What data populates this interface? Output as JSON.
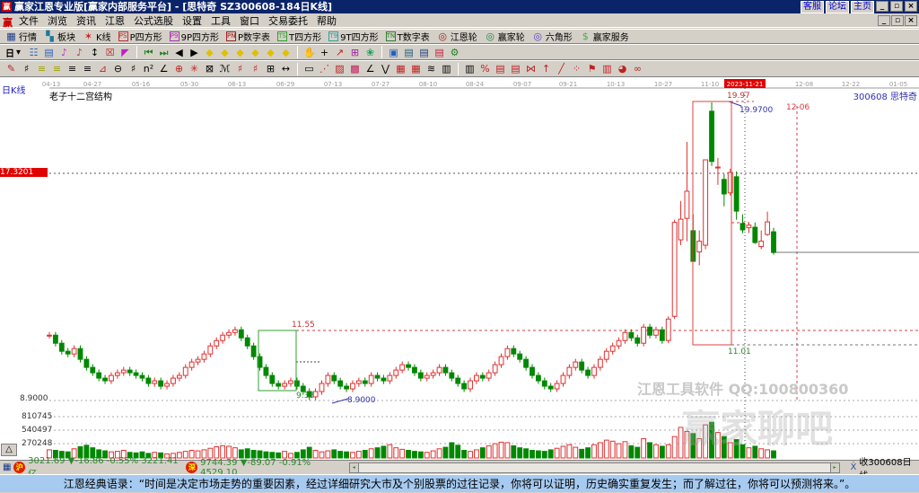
{
  "window": {
    "title": "赢家江恩专业版[赢家内部服务平台] - [思特奇   SZ300608-184日K线]",
    "logo": "赢",
    "links": [
      "客服",
      "论坛",
      "主页"
    ],
    "min": "_",
    "max": "▫",
    "close": "×"
  },
  "menu": [
    "文件",
    "浏览",
    "资讯",
    "江恩",
    "公式选股",
    "设置",
    "工具",
    "窗口",
    "交易委托",
    "帮助"
  ],
  "toolbar1": [
    {
      "icon": "grid-icon",
      "tag": "▦",
      "label": "行情",
      "color": "#1a3a8a"
    },
    {
      "icon": "blocks-icon",
      "tag": "▚",
      "label": "板块",
      "color": "#1a7a9a"
    },
    {
      "icon": "kline-icon",
      "tag": "✶",
      "label": "K线",
      "color": "#d02020"
    },
    {
      "icon": "ps-icon",
      "tag": "PS",
      "label": "P四方形",
      "color": "#c03030"
    },
    {
      "icon": "p9-icon",
      "tag": "P9",
      "label": "9P四方形",
      "color": "#b030b0"
    },
    {
      "icon": "pn-icon",
      "tag": "PN",
      "label": "P数字表",
      "color": "#a02020"
    },
    {
      "icon": "ts-icon",
      "tag": "TS",
      "label": "T四方形",
      "color": "#30a030"
    },
    {
      "icon": "t9-icon",
      "tag": "T9",
      "label": "9T四方形",
      "color": "#30a0a0"
    },
    {
      "icon": "tn-icon",
      "tag": "TN",
      "label": "T数字表",
      "color": "#308030"
    },
    {
      "icon": "gann-wheel-icon",
      "tag": "◎",
      "label": "江恩轮",
      "color": "#a02020"
    },
    {
      "icon": "winner-wheel-icon",
      "tag": "◎",
      "label": "赢家轮",
      "color": "#208040"
    },
    {
      "icon": "hexagon-icon",
      "tag": "◎",
      "label": "六角形",
      "color": "#6040c0"
    },
    {
      "icon": "dollar-icon",
      "tag": "$",
      "label": "赢家服务",
      "color": "#40b040"
    }
  ],
  "toolbar2": {
    "period": "日",
    "icons": [
      [
        "chart-type-icon",
        "☷",
        "#3060c0"
      ],
      [
        "list-icon",
        "▤",
        "#3060c0"
      ],
      [
        "indicator-a-icon",
        "♪",
        "#c030c0"
      ],
      [
        "indicator-b-icon",
        "♪",
        "#c03060"
      ],
      [
        "candle-select-icon",
        "↕",
        "#000"
      ],
      [
        "compare-icon",
        "☒",
        "#c02020"
      ],
      [
        "color-flag-icon",
        "◤",
        "#c020c0"
      ],
      [
        "first-icon",
        "⏮",
        "#208020"
      ],
      [
        "last-icon",
        "⏭",
        "#208020"
      ],
      [
        "left-icon",
        "◀",
        "#000"
      ],
      [
        "right-icon",
        "▶",
        "#000"
      ],
      [
        "zoom-a-icon",
        "◆",
        "#e0c000"
      ],
      [
        "zoom-b-icon",
        "◆",
        "#e0c000"
      ],
      [
        "zoom-c-icon",
        "◆",
        "#e0c000"
      ],
      [
        "zoom-d-icon",
        "◆",
        "#e0c000"
      ],
      [
        "zoom-e-icon",
        "◆",
        "#e0c000"
      ],
      [
        "zoom-f-icon",
        "◆",
        "#e0c000"
      ],
      [
        "hand-icon",
        "✋",
        "#000"
      ],
      [
        "crosshair-icon",
        "+",
        "#000"
      ],
      [
        "draw-line-icon",
        "↗",
        "#c02020"
      ],
      [
        "calc-icon",
        "⊞",
        "#a020a0"
      ],
      [
        "brain-icon",
        "❀",
        "#20a060"
      ],
      [
        "calendar-icon",
        "▣",
        "#2060c0"
      ],
      [
        "save-a-icon",
        "▤",
        "#206080"
      ],
      [
        "save-b-icon",
        "▤",
        "#204080"
      ],
      [
        "disk-icon",
        "▤",
        "#c02040"
      ],
      [
        "network-icon",
        "⚙",
        "#208020"
      ]
    ]
  },
  "toolbar3": {
    "icons": [
      [
        "pen-icon",
        "✎",
        "#c02020"
      ],
      [
        "hash-icon",
        "♯",
        "#000"
      ],
      [
        "gann-a-icon",
        "≡",
        "#a0a000"
      ],
      [
        "gann-b-icon",
        "≡",
        "#a0a000"
      ],
      [
        "gann-c-icon",
        "≡",
        "#000"
      ],
      [
        "gann-d-icon",
        "≡",
        "#000"
      ],
      [
        "fan-icon",
        "⊿",
        "#c02020"
      ],
      [
        "circle-icon",
        "⊖",
        "#000"
      ],
      [
        "grid-lines-icon",
        "♯",
        "#000"
      ],
      [
        "n2-icon",
        "n²",
        "#000"
      ],
      [
        "angle-icon",
        "∠",
        "#000"
      ],
      [
        "target-icon",
        "⊕",
        "#c02020"
      ],
      [
        "star-icon",
        "✳",
        "#c02020"
      ],
      [
        "box-icon",
        "⊠",
        "#000"
      ],
      [
        "wave-icon",
        "ℳ",
        "#000"
      ],
      [
        "red-a-icon",
        "♯",
        "#c02020"
      ],
      [
        "red-b-icon",
        "♯",
        "#c02020"
      ],
      [
        "bars-icon",
        "⊞",
        "#000"
      ],
      [
        "range-icon",
        "↔",
        "#000"
      ],
      [
        "rect-icon",
        "▭",
        "#000"
      ],
      [
        "fan-lines-icon",
        "⋰",
        "#c02020"
      ],
      [
        "square-fan-icon",
        "▨",
        "#c02020"
      ],
      [
        "square-grid-icon",
        "▩",
        "#c02060"
      ],
      [
        "angle-lines-icon",
        "∠",
        "#000"
      ],
      [
        "zigzag-icon",
        "⋁",
        "#000"
      ],
      [
        "matrix-icon",
        "▦",
        "#c02020"
      ],
      [
        "matrix-b-icon",
        "▦",
        "#c02020"
      ],
      [
        "parallel-icon",
        "≋",
        "#000"
      ],
      [
        "table-icon",
        "▥",
        "#000"
      ],
      [
        "table-b-icon",
        "▥",
        "#000"
      ],
      [
        "percent-icon",
        "%",
        "#c02020"
      ],
      [
        "bars2-icon",
        "▤",
        "#c02020"
      ],
      [
        "bars3-icon",
        "▤",
        "#c02020"
      ],
      [
        "cycle-icon",
        "⋈",
        "#c02020"
      ],
      [
        "arrow-icon",
        "↑",
        "#c02020"
      ],
      [
        "line-tool-icon",
        "╱",
        "#c02020"
      ],
      [
        "dots-icon",
        "⁘",
        "#c02020"
      ],
      [
        "flag-icon",
        "⚑",
        "#c02020"
      ],
      [
        "chart-icon",
        "▥",
        "#c02020"
      ],
      [
        "pie-icon",
        "◕",
        "#c02020"
      ],
      [
        "loop-icon",
        "∞",
        "#c02020"
      ]
    ]
  },
  "chart": {
    "period_label": "日K线",
    "study_title": "老子十二宫结构",
    "symbol": "300608  思特奇",
    "price_tag": "17.3201",
    "low_label": "8.9000",
    "vol_ticks": [
      "810745",
      "540497",
      "270248"
    ],
    "dates": [
      "04-13",
      "04-27",
      "05-16",
      "05-30",
      "06-13",
      "06-29",
      "07-13",
      "07-27",
      "08-10",
      "08-24",
      "09-07",
      "09-21",
      "10-13",
      "10-27",
      "11-10",
      "2023-11-21",
      "12-08",
      "12-22",
      "01-05"
    ],
    "annotations": {
      "high": "19.97",
      "high_val": "19.9700",
      "low_box_top": "11.55",
      "low_box_bottom": "9.38",
      "low_val": "8.9000",
      "box_low": "11.01",
      "future_date": "12-06"
    },
    "watermark": "江恩工具软件  QQ:100800360",
    "watermark_logo": "赢家聊吧",
    "colors": {
      "up": "#e03030",
      "down": "#008800",
      "accent": "#d00000"
    }
  },
  "chart_data": {
    "type": "candlestick",
    "x_range": [
      "2023-04-13",
      "2024-01-05"
    ],
    "ylim": [
      8.9,
      19.97
    ],
    "early_close": [
      11.3,
      11.0,
      10.7,
      10.6,
      10.8,
      10.4,
      10.1,
      9.9,
      9.7,
      9.6,
      9.8,
      9.9,
      10.0,
      9.9,
      9.8,
      9.7,
      9.5,
      9.6,
      9.4,
      9.5,
      9.7,
      9.8,
      10.1,
      10.3,
      10.4,
      10.6,
      10.9,
      11.1,
      11.3,
      11.4,
      11.5,
      11.2,
      10.9,
      10.5,
      10.1,
      9.8,
      9.5,
      9.4,
      9.5,
      9.6,
      9.4,
      9.2,
      9.0,
      9.2,
      9.5,
      9.8,
      9.6,
      9.4,
      9.3,
      9.5,
      9.6,
      9.5,
      9.8,
      9.7,
      9.6,
      9.8,
      10.0,
      10.2,
      10.1,
      9.9,
      9.7,
      9.8,
      9.9,
      10.1,
      9.9,
      9.7,
      9.5,
      9.3,
      9.6,
      9.8,
      9.7,
      9.9,
      10.2,
      10.5,
      10.8,
      10.6,
      10.4,
      10.1,
      9.8,
      9.6,
      9.4,
      9.3,
      9.5,
      9.8,
      10.1,
      10.3,
      10.0,
      9.8,
      10.1,
      10.4,
      10.7,
      10.9,
      11.1,
      11.4,
      11.2,
      11.0,
      11.6,
      11.3,
      11.5,
      11.1
    ],
    "ohlc": [
      [
        11.1,
        12.0,
        11.0,
        11.9
      ],
      [
        12.0,
        15.6,
        11.9,
        15.5
      ],
      [
        14.85,
        16.3,
        14.65,
        15.62
      ],
      [
        15.65,
        18.5,
        14.8,
        16.66
      ],
      [
        15.19,
        15.8,
        14.1,
        14.05
      ],
      [
        14.4,
        15.2,
        13.9,
        14.8
      ],
      [
        14.65,
        16.8,
        14.5,
        17.83
      ],
      [
        19.64,
        19.97,
        17.6,
        17.77
      ],
      [
        17.56,
        17.9,
        16.9,
        17.56
      ],
      [
        17.1,
        17.3,
        16.1,
        16.56
      ],
      [
        16.6,
        17.5,
        16.5,
        17.36
      ],
      [
        17.2,
        17.4,
        15.6,
        15.92
      ],
      [
        15.46,
        15.8,
        15.1,
        15.22
      ],
      [
        15.3,
        15.5,
        15.1,
        15.4
      ],
      [
        15.32,
        15.5,
        14.7,
        14.75
      ],
      [
        14.6,
        15.2,
        14.5,
        14.8
      ],
      [
        15.05,
        15.9,
        15.0,
        15.52
      ],
      [
        15.15,
        15.3,
        14.3,
        14.38
      ]
    ],
    "volume": [
      160000,
      150000,
      130000,
      120000,
      180000,
      220000,
      250000,
      200000,
      160000,
      140000,
      120000,
      130000,
      150000,
      110000,
      100000,
      120000,
      90000,
      110000,
      100000,
      80000,
      90000,
      110000,
      130000,
      150000,
      140000,
      160000,
      190000,
      220000,
      240000,
      230000,
      200000,
      160000,
      180000,
      150000,
      140000,
      120000,
      110000,
      100000,
      130000,
      90000,
      110000,
      160000,
      210000,
      150000,
      120000,
      140000,
      160000,
      130000,
      120000,
      110000,
      130000,
      150000,
      180000,
      200000,
      230000,
      260000,
      200000,
      170000,
      150000,
      130000,
      120000,
      110000,
      140000,
      180000,
      210000,
      300000,
      250000,
      150000,
      130000,
      160000,
      200000,
      240000,
      280000,
      310000,
      300000,
      240000,
      200000,
      180000,
      150000,
      140000,
      130000,
      160000,
      190000,
      230000,
      260000,
      210000,
      170000,
      200000,
      260000,
      300000,
      350000,
      330000,
      280000,
      320000,
      240000,
      210000,
      380000,
      300000,
      260000,
      230000,
      260000,
      420000,
      600000,
      520000,
      480000,
      380000,
      650000,
      700000,
      500000,
      420000,
      300000,
      360000,
      260000,
      200000,
      230000,
      180000,
      160000,
      140000
    ]
  },
  "status": {
    "sh": {
      "icon": "沪",
      "text": "3021.69 ▼-16.86 -0.55% 3221.41亿"
    },
    "sz": {
      "icon": "深",
      "text": "9744.39 ▼-89.07 -0.91% 4529.10"
    },
    "right": "收300608日线"
  },
  "quote": "江恩经典语录：“时间是决定市场走势的重要因素，经过详细研究大市及个别股票的过往记录，你将可以证明，历史确实重复发生；而了解过往，你将可以预测将来。”。"
}
